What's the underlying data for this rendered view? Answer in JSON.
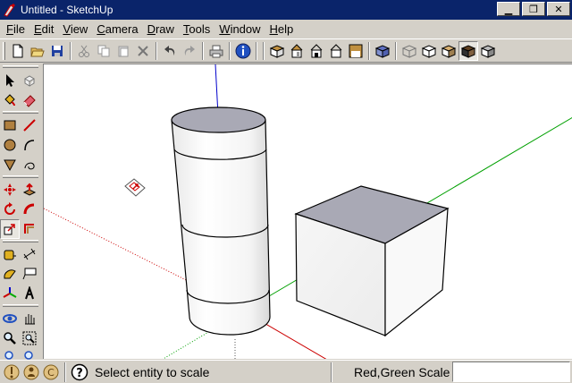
{
  "window": {
    "title": "Untitled - SketchUp",
    "minimize_glyph": "▁",
    "restore_glyph": "❐",
    "close_glyph": "✕"
  },
  "menu": [
    {
      "label": "File",
      "key": "F",
      "rest": "ile"
    },
    {
      "label": "Edit",
      "key": "E",
      "rest": "dit"
    },
    {
      "label": "View",
      "key": "V",
      "rest": "iew"
    },
    {
      "label": "Camera",
      "key": "C",
      "rest": "amera"
    },
    {
      "label": "Draw",
      "key": "D",
      "rest": "raw"
    },
    {
      "label": "Tools",
      "key": "T",
      "rest": "ools"
    },
    {
      "label": "Window",
      "key": "W",
      "rest": "indow"
    },
    {
      "label": "Help",
      "key": "H",
      "rest": "elp"
    }
  ],
  "toolbar": {
    "icons": [
      "new-icon",
      "open-icon",
      "save-icon",
      "cut-icon",
      "copy-icon",
      "paste-icon",
      "erase-icon",
      "undo-icon",
      "redo-icon",
      "print-icon",
      "model-info-icon",
      "iso-view-icon",
      "top-view-icon",
      "front-view-icon",
      "right-view-icon",
      "back-view-icon",
      "left-view-icon",
      "xray-icon",
      "wireframe-icon",
      "hidden-line-icon",
      "shaded-icon",
      "shaded-textures-icon",
      "monochrome-icon"
    ]
  },
  "left_tools": [
    "select-icon",
    "component-icon",
    "paint-bucket-icon",
    "eraser-icon",
    "rectangle-icon",
    "line-icon",
    "circle-icon",
    "arc-icon",
    "polygon-icon",
    "freehand-icon",
    "move-icon",
    "push-pull-icon",
    "rotate-icon",
    "follow-me-icon",
    "scale-icon",
    "offset-icon",
    "tape-measure-icon",
    "dimension-icon",
    "protractor-icon",
    "text-icon",
    "axes-icon",
    "3d-text-icon",
    "orbit-icon",
    "pan-icon",
    "zoom-icon",
    "zoom-window-icon",
    "zoom-extents-icon",
    "previous-view-icon"
  ],
  "status": {
    "message": "Select entity to scale",
    "vcb_label": "Red,Green Scale",
    "vcb_value": ""
  },
  "colors": {
    "titlebar": "#0a246a",
    "chrome": "#d4d0c8",
    "viewport": "#ffffff",
    "axis_red": "#cc0000",
    "axis_green": "#00a000",
    "axis_blue": "#0000cc",
    "top_face": "#a9a9b5"
  }
}
